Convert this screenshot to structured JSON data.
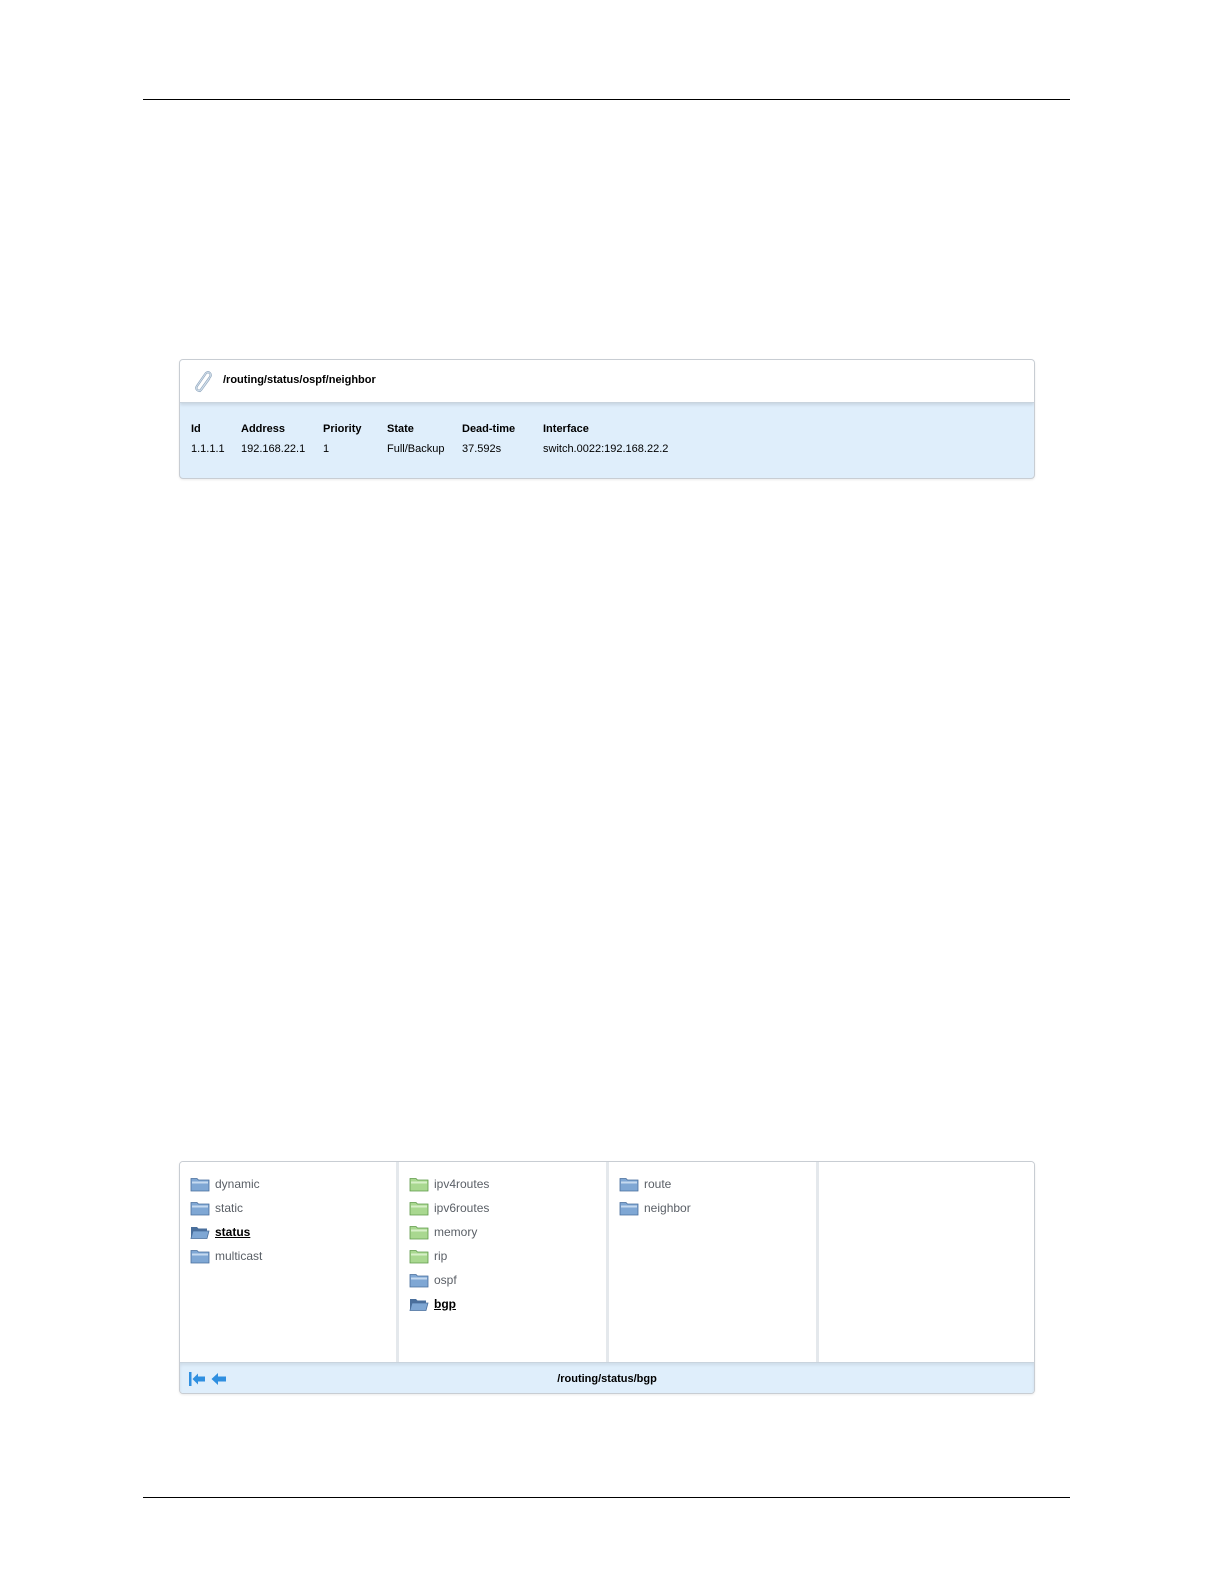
{
  "neighbor_panel": {
    "path": "/routing/status/ospf/neighbor",
    "icon": "paperclip-icon",
    "columns": [
      "Id",
      "Address",
      "Priority",
      "State",
      "Dead-time",
      "Interface"
    ],
    "rows": [
      [
        "1.1.1.1",
        "192.168.22.1",
        "1",
        "Full/Backup",
        "37.592s",
        "switch.0022:192.168.22.2"
      ]
    ]
  },
  "browser_panel": {
    "column1": [
      {
        "label": "dynamic",
        "icon": "folder-icon",
        "color": "blue"
      },
      {
        "label": "static",
        "icon": "folder-icon",
        "color": "blue"
      },
      {
        "label": "status",
        "icon": "folder-open-icon",
        "color": "blue",
        "selected": true
      },
      {
        "label": "multicast",
        "icon": "folder-icon",
        "color": "blue"
      }
    ],
    "column2": [
      {
        "label": "ipv4routes",
        "icon": "folder-icon",
        "color": "green"
      },
      {
        "label": "ipv6routes",
        "icon": "folder-icon",
        "color": "green"
      },
      {
        "label": "memory",
        "icon": "folder-icon",
        "color": "green"
      },
      {
        "label": "rip",
        "icon": "folder-icon",
        "color": "green"
      },
      {
        "label": "ospf",
        "icon": "folder-icon",
        "color": "blue"
      },
      {
        "label": "bgp",
        "icon": "folder-open-icon",
        "color": "blue",
        "selected": true
      }
    ],
    "column3": [
      {
        "label": "route",
        "icon": "folder-icon",
        "color": "blue"
      },
      {
        "label": "neighbor",
        "icon": "folder-icon",
        "color": "blue"
      }
    ],
    "column4": [],
    "footer": {
      "first_icon": "first-arrow-icon",
      "back_icon": "back-arrow-icon",
      "path": "/routing/status/bgp"
    }
  },
  "colors": {
    "folder_blue": "#7fa7d4",
    "folder_green": "#a9d890",
    "panel_blue": "#dfeefb",
    "nav_arrow": "#2f8fe0"
  }
}
